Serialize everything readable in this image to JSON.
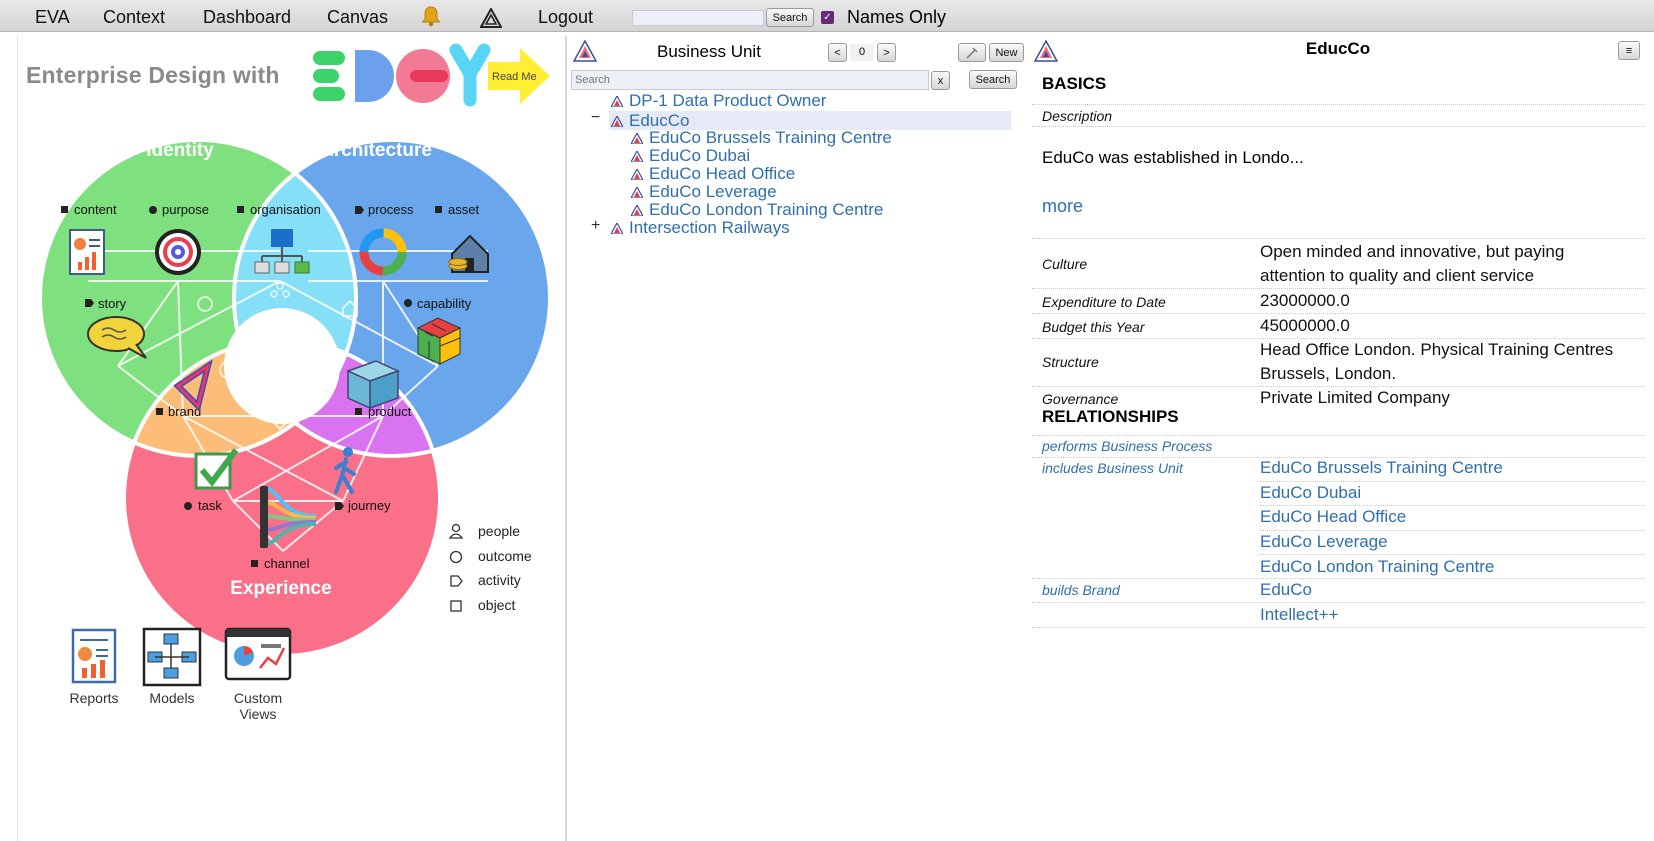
{
  "topbar": {
    "menu": [
      "EVA",
      "Context",
      "Dashboard",
      "Canvas"
    ],
    "logout": "Logout",
    "search_value": "",
    "search_button": "Search",
    "names_only_checked": true,
    "names_only_label": "Names Only"
  },
  "edgy": {
    "banner_text": "Enterprise Design with",
    "read_me": "Read Me",
    "titles": {
      "identity": "Identity",
      "architecture": "Architecture",
      "experience": "Experience"
    },
    "labels": {
      "content": "content",
      "purpose": "purpose",
      "organisation": "organisation",
      "process": "process",
      "asset": "asset",
      "story": "story",
      "capability": "capability",
      "brand": "brand",
      "product": "product",
      "task": "task",
      "journey": "journey",
      "channel": "channel"
    },
    "legend": [
      "people",
      "outcome",
      "activity",
      "object"
    ],
    "bottom_icons": [
      "Reports",
      "Models",
      "Custom\nViews"
    ],
    "colors": {
      "identity": "#7ee07e",
      "architecture": "#6aa6ec",
      "experience": "#f97088",
      "brand": "#fbbd77",
      "product": "#d973f0",
      "organisation": "#84dff7",
      "accent": "#2f6fb0"
    }
  },
  "tree": {
    "title": "Business Unit",
    "prev": "<",
    "page": "0",
    "next": ">",
    "new_button": "New",
    "search_placeholder": "Search",
    "clear_button": "x",
    "search_button": "Search",
    "collapse_symbol": "−",
    "expand_symbol": "+",
    "items": [
      "DP-1 Data Product Owner",
      "EducCo",
      "EduCo Brussels Training Centre",
      "EduCo Dubai",
      "EduCo Head Office",
      "EduCo Leverage",
      "EduCo London Training Centre",
      "Intersection Railways"
    ]
  },
  "detail": {
    "title": "EducCo",
    "menu_icon": "≡",
    "basics_heading": "BASICS",
    "description_label": "Description",
    "description_text": "EduCo was established in Londo...",
    "more_link": "more",
    "properties": [
      {
        "key": "Culture",
        "value": "Open minded and innovative, but paying attention to quality and client service"
      },
      {
        "key": "Expenditure to Date",
        "value": "23000000.0"
      },
      {
        "key": "Budget this Year",
        "value": "45000000.0"
      },
      {
        "key": "Structure",
        "value": "Head Office London. Physical Training Centres Brussels, London."
      },
      {
        "key": "Governance",
        "value": "Private Limited Company"
      }
    ],
    "relationships_heading": "RELATIONSHIPS",
    "relationships": [
      {
        "key": "performs Business Process",
        "values": []
      },
      {
        "key": "includes Business Unit",
        "values": [
          "EduCo Brussels Training Centre",
          "EduCo Dubai",
          "EduCo Head Office",
          "EduCo Leverage",
          "EduCo London Training Centre"
        ]
      },
      {
        "key": "builds Brand",
        "values": [
          "EduCo",
          "Intellect++"
        ]
      }
    ]
  }
}
